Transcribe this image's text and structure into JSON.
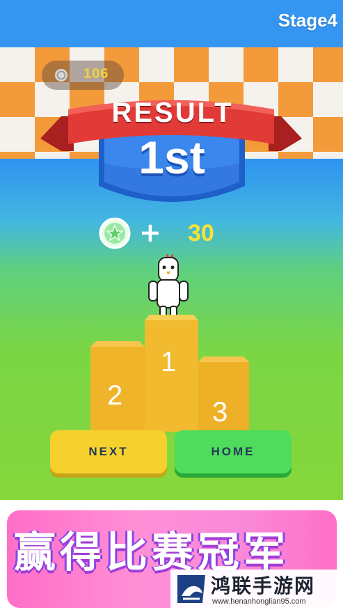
{
  "hud": {
    "stage_label": "Stage4",
    "coins": "106",
    "coin_icon": "coin-icon"
  },
  "result": {
    "banner_title": "RESULT",
    "place": "1st",
    "reward_plus": "+",
    "reward_amount": "30",
    "reward_icon": "star-coin-icon"
  },
  "podium": {
    "first": "1",
    "second": "2",
    "third": "3"
  },
  "buttons": {
    "next_label": "NEXT",
    "home_label": "HOME"
  },
  "promo": {
    "banner_text": "赢得比赛冠军"
  },
  "watermark": {
    "title": "鸿联手游网",
    "url": "www.henanhonglian95.com"
  },
  "colors": {
    "ribbon_red": "#d8322f",
    "shield_blue": "#2f7de6",
    "next_yellow": "#f6d12d",
    "home_green": "#4fdb5b",
    "promo_pink": "#ff7fd3",
    "coin_yellow": "#f4d33a"
  }
}
